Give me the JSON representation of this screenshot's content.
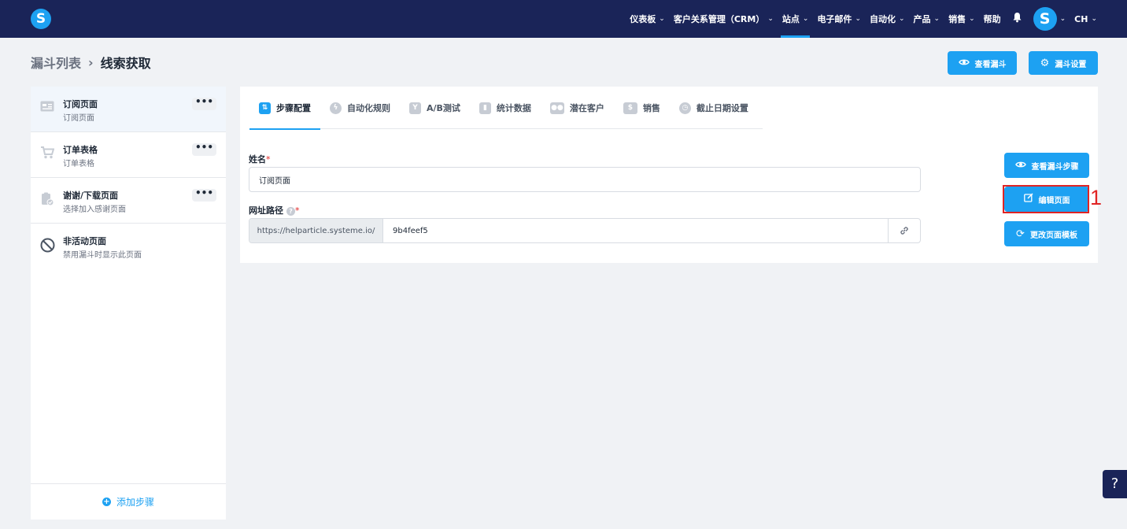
{
  "nav": {
    "logo": "S",
    "items": [
      {
        "label": "仪表板",
        "chev": "⌄",
        "active": false
      },
      {
        "label": "客户关系管理（CRM）",
        "chev": "⌄",
        "active": false
      },
      {
        "label": "站点",
        "chev": "⌄",
        "active": true
      },
      {
        "label": "电子邮件",
        "chev": "⌄",
        "active": false
      },
      {
        "label": "自动化",
        "chev": "⌄",
        "active": false
      },
      {
        "label": "产品",
        "chev": "⌄",
        "active": false
      },
      {
        "label": "销售",
        "chev": "⌄",
        "active": false
      },
      {
        "label": "帮助",
        "chev": "",
        "active": false
      }
    ],
    "avatar": "S",
    "lang": "CH"
  },
  "breadcrumb": {
    "parent": "漏斗列表",
    "separator": "›",
    "current": "线索获取"
  },
  "header_buttons": {
    "view_funnel": "查看漏斗",
    "funnel_settings": "漏斗设置"
  },
  "steps": [
    {
      "title": "订阅页面",
      "subtitle": "订阅页面",
      "icon": "page-icon"
    },
    {
      "title": "订单表格",
      "subtitle": "订单表格",
      "icon": "cart-icon"
    },
    {
      "title": "谢谢/下载页面",
      "subtitle": "选择加入感谢页面",
      "icon": "thanks-page-icon"
    },
    {
      "title": "非活动页面",
      "subtitle": "禁用漏斗时显示此页面",
      "icon": "disabled-icon"
    }
  ],
  "more_label": "•••",
  "add_step": "添加步骤",
  "tabs": [
    {
      "label": "步骤配置",
      "icon": "settings-icon"
    },
    {
      "label": "自动化规则",
      "icon": "bolt-icon"
    },
    {
      "label": "A/B测试",
      "icon": "split-icon"
    },
    {
      "label": "统计数据",
      "icon": "stats-icon"
    },
    {
      "label": "潜在客户",
      "icon": "users-icon"
    },
    {
      "label": "销售",
      "icon": "dollar-icon"
    },
    {
      "label": "截止日期设置",
      "icon": "clock-icon"
    }
  ],
  "form": {
    "name_label": "姓名",
    "name_value": "订阅页面",
    "path_label": "网址路径",
    "url_prefix": "https://helparticle.systeme.io/",
    "path_value": "9b4feef5",
    "required_mark": "*"
  },
  "side_buttons": {
    "view_step": "查看漏斗步骤",
    "edit_page": "编辑页面",
    "change_template": "更改页面模板"
  },
  "annotation": {
    "marker": "1"
  },
  "help_label": "?",
  "colors": {
    "nav_bg": "#1a2458",
    "accent": "#1da1f2",
    "highlight": "#e02424"
  }
}
